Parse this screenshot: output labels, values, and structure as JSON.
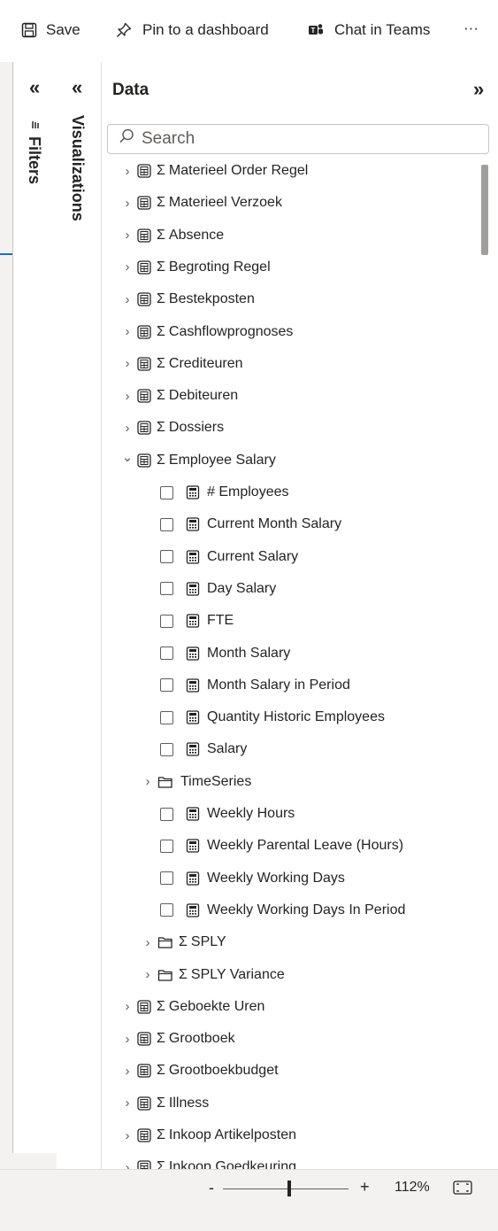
{
  "toolbar": {
    "save_label": "Save",
    "pin_label": "Pin to a dashboard",
    "chat_label": "Chat in Teams",
    "more_label": "···"
  },
  "filters_pane": {
    "label": "Filters",
    "collapse_icon": "«"
  },
  "visualizations_pane": {
    "label": "Visualizations",
    "collapse_icon": "«"
  },
  "data_pane": {
    "title": "Data",
    "expand_icon": "»",
    "search_placeholder": "Search"
  },
  "tree": [
    {
      "kind": "table",
      "label": "Materieel Order Regel",
      "expanded": false
    },
    {
      "kind": "table",
      "label": "Materieel Verzoek",
      "expanded": false
    },
    {
      "kind": "table",
      "label": "Absence",
      "expanded": false
    },
    {
      "kind": "table",
      "label": "Begroting Regel",
      "expanded": false
    },
    {
      "kind": "table",
      "label": "Bestekposten",
      "expanded": false
    },
    {
      "kind": "table",
      "label": "Cashflowprognoses",
      "expanded": false
    },
    {
      "kind": "table",
      "label": "Crediteuren",
      "expanded": false
    },
    {
      "kind": "table",
      "label": "Debiteuren",
      "expanded": false
    },
    {
      "kind": "table",
      "label": "Dossiers",
      "expanded": false
    },
    {
      "kind": "table",
      "label": "Employee Salary",
      "expanded": true
    },
    {
      "kind": "measure",
      "label": "# Employees"
    },
    {
      "kind": "measure",
      "label": "Current Month Salary"
    },
    {
      "kind": "measure",
      "label": "Current Salary"
    },
    {
      "kind": "measure",
      "label": "Day Salary"
    },
    {
      "kind": "measure",
      "label": "FTE"
    },
    {
      "kind": "measure",
      "label": "Month Salary"
    },
    {
      "kind": "measure",
      "label": "Month Salary in Period"
    },
    {
      "kind": "measure",
      "label": "Quantity Historic Employees"
    },
    {
      "kind": "measure",
      "label": "Salary"
    },
    {
      "kind": "folder",
      "label": "TimeSeries",
      "sigma": false
    },
    {
      "kind": "measure",
      "label": "Weekly Hours"
    },
    {
      "kind": "measure",
      "label": "Weekly Parental Leave (Hours)"
    },
    {
      "kind": "measure",
      "label": "Weekly Working Days"
    },
    {
      "kind": "measure",
      "label": "Weekly Working Days In Period"
    },
    {
      "kind": "folder",
      "label": "SPLY",
      "sigma": true
    },
    {
      "kind": "folder",
      "label": "SPLY Variance",
      "sigma": true
    },
    {
      "kind": "table",
      "label": "Geboekte Uren",
      "expanded": false
    },
    {
      "kind": "table",
      "label": "Grootboek",
      "expanded": false
    },
    {
      "kind": "table",
      "label": "Grootboekbudget",
      "expanded": false
    },
    {
      "kind": "table",
      "label": "Illness",
      "expanded": false
    },
    {
      "kind": "table",
      "label": "Inkoop Artikelposten",
      "expanded": false
    },
    {
      "kind": "table",
      "label": "Inkoop Goedkeuring",
      "expanded": false
    }
  ],
  "status": {
    "zoom_minus": "-",
    "zoom_plus": "+",
    "zoom_value": "112%",
    "zoom_level": 0.53
  },
  "colors": {
    "accent": "#1a6fc4",
    "pane_bg": "#ffffff",
    "canvas_bg": "#f3f2f1"
  }
}
